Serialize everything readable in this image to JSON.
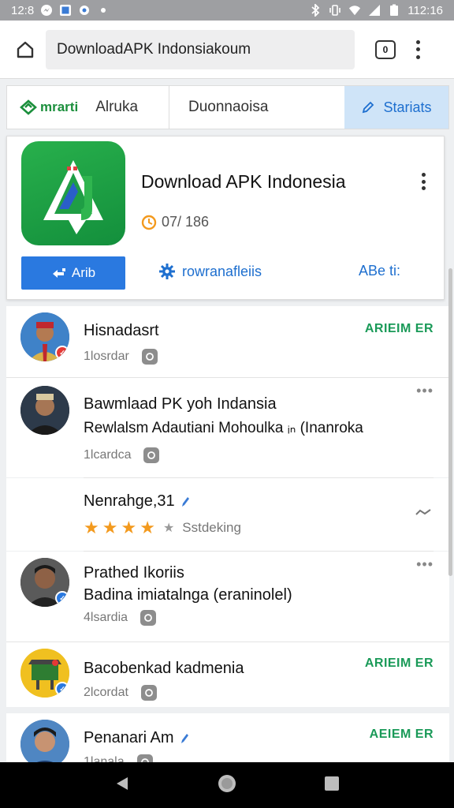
{
  "status_bar": {
    "time": "12:8",
    "clock_right": "112:16",
    "icons_left": [
      "messenger-icon",
      "gallery-icon",
      "app-icon",
      "dot-icon"
    ],
    "icons_right": [
      "bluetooth-icon",
      "vibrate-icon",
      "wifi-icon",
      "signal-icon",
      "battery-icon"
    ]
  },
  "browser": {
    "url": "DownloadAPK Indonsiakoum",
    "tab_count": "0"
  },
  "tabbar": {
    "brand": "mrarti",
    "tab1_label": "Alruka",
    "tab2_label": "Duonnaoisa",
    "tab3_label": "Stariats",
    "accent": "#1e6fcf",
    "brand_color": "#1b8f3c"
  },
  "app_card": {
    "title": "Download APK Indonesia",
    "meta": "07/ 186",
    "primary_button": "Arib",
    "link_button": "rowranafleiis",
    "link_button2": "ABe ti:",
    "icon_color": "#1f9e45"
  },
  "feed": [
    {
      "title": "Hisnadasrt",
      "sub": "1losrdar",
      "tag": "ARIEIM ER"
    },
    {
      "title": "Bawmlaad PK yoh Indansia",
      "title2": "Rewlalsm Adautiani Mohoulka ᵢₙ (Inanroka",
      "sub": "1lcardca",
      "more": "•••"
    },
    {
      "title": "Nenrahge,31",
      "rating": 3.5,
      "rating_label": "Sstdeking",
      "rating_color": "#f39a1e"
    },
    {
      "title": "Prathed Ikoriis",
      "title2": "Badina imiatalnga (eraninolel)",
      "sub": "4lsardia",
      "more": "•••"
    },
    {
      "title": "Bacobenkad kadmenia",
      "sub": "2lcordat",
      "tag": "ARIEIM ER"
    },
    {
      "title": "Penanari Am",
      "sub": "1lanala",
      "tag": "AEIEM ER"
    }
  ]
}
